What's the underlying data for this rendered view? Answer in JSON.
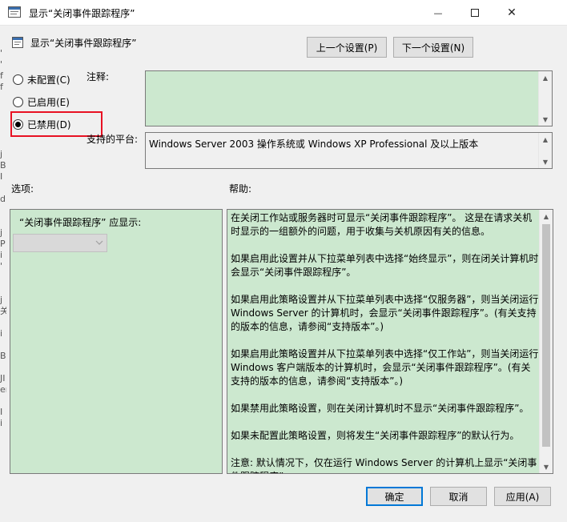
{
  "window": {
    "title": "显示“关闭事件跟踪程序”",
    "minimize": "—",
    "close": "✕"
  },
  "left_strip": [
    "'",
    "'",
    "f",
    "f",
    "",
    "",
    "",
    "",
    "",
    "j",
    "B",
    "I",
    "",
    "d",
    "",
    "",
    "j",
    "P",
    "i",
    "'",
    "",
    "",
    "j",
    "关",
    "",
    "i",
    "",
    "B",
    "",
    "JI",
    "er",
    "",
    "I",
    "i"
  ],
  "header": {
    "title": "显示“关闭事件跟踪程序”",
    "prev_label": "上一个设置(P)",
    "next_label": "下一个设置(N)"
  },
  "radios": [
    {
      "label": "未配置(C)",
      "checked": false
    },
    {
      "label": "已启用(E)",
      "checked": false
    },
    {
      "label": "已禁用(D)",
      "checked": true
    }
  ],
  "comment": {
    "label": "注释:",
    "value": ""
  },
  "platform": {
    "label": "支持的平台:",
    "value": "Windows Server 2003 操作系统或 Windows XP Professional 及以上版本"
  },
  "options": {
    "label": "选项:",
    "prompt": "“关闭事件跟踪程序” 应显示:",
    "combo_value": ""
  },
  "help": {
    "label": "帮助:",
    "paragraphs": [
      "在关闭工作站或服务器时可显示“关闭事件跟踪程序”。 这是在请求关机时显示的一组额外的问题，用于收集与关机原因有关的信息。",
      "如果启用此设置并从下拉菜单列表中选择“始终显示”，则在闭关计算机时会显示“关闭事件跟踪程序”。",
      "如果启用此策略设置并从下拉菜单列表中选择“仅服务器”，则当关闭运行 Windows Server 的计算机时，会显示“关闭事件跟踪程序”。(有关支持的版本的信息，请参阅“支持版本”。)",
      "如果启用此策略设置并从下拉菜单列表中选择“仅工作站”，则当关闭运行 Windows 客户端版本的计算机时，会显示“关闭事件跟踪程序”。(有关支持的版本的信息，请参阅“支持版本”。)",
      "如果禁用此策略设置，则在关闭计算机时不显示“关闭事件跟踪程序”。",
      "如果未配置此策略设置，则将发生“关闭事件跟踪程序”的默认行为。",
      "注意: 默认情况下，仅在运行 Windows Server 的计算机上显示“关闭事件跟踪程序”。"
    ]
  },
  "footer": {
    "ok": "确定",
    "cancel": "取消",
    "apply": "应用(A)"
  },
  "colors": {
    "panel_green": "#cce8cf",
    "dialog_bg": "#f0f0f0",
    "highlight_red": "#e81123",
    "accent_blue": "#0078d7"
  }
}
